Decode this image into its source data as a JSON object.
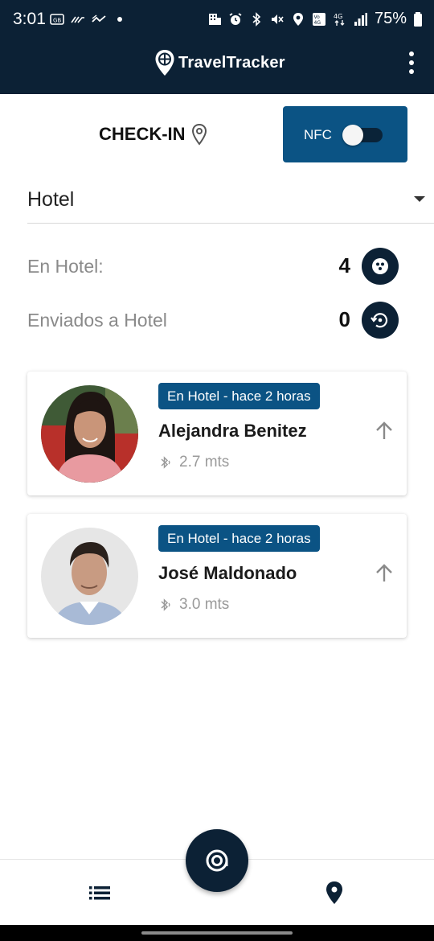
{
  "status_bar": {
    "time": "3:01",
    "battery": "75%",
    "network": "4G"
  },
  "app_bar": {
    "title": "TravelTracker",
    "menu_icon": "more-vert-icon"
  },
  "checkin": {
    "label": "CHECK-IN",
    "icon": "location-pin-icon"
  },
  "nfc": {
    "label": "NFC",
    "enabled": false
  },
  "location_select": {
    "value": "Hotel"
  },
  "counters": [
    {
      "label": "En Hotel:",
      "value": "4",
      "icon": "group-icon"
    },
    {
      "label": "Enviados a Hotel",
      "value": "0",
      "icon": "history-icon"
    }
  ],
  "travelers": [
    {
      "status": "En Hotel - hace 2 horas",
      "name": "Alejandra Benitez",
      "distance": "2.7 mts"
    },
    {
      "status": "En Hotel - hace 2 horas",
      "name": "José Maldonado",
      "distance": "3.0 mts"
    }
  ],
  "bottom_nav": {
    "left_icon": "list-icon",
    "center_icon": "scan-target-icon",
    "right_icon": "map-pin-icon"
  },
  "colors": {
    "app_bar": "#0c2135",
    "accent": "#0b5384",
    "label_gray": "#8a8a8a"
  }
}
